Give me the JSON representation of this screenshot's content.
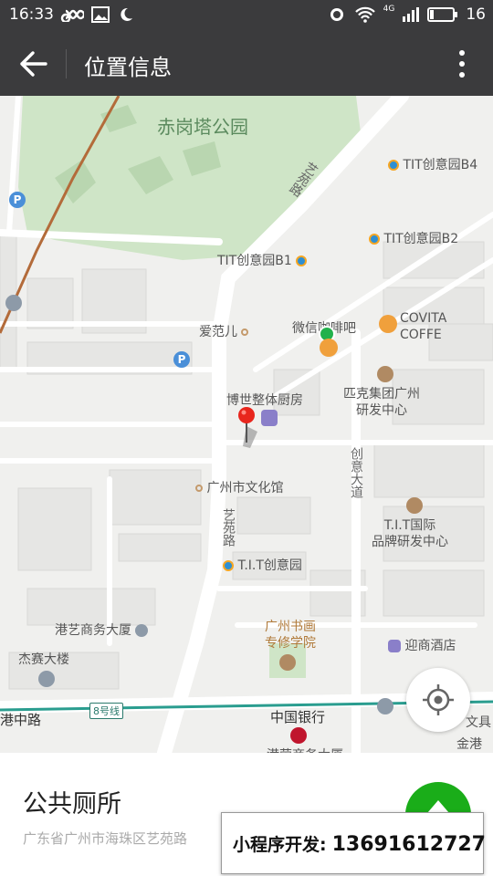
{
  "status_bar": {
    "time": "16:33",
    "network_label": "4G",
    "battery": "16"
  },
  "navbar": {
    "title": "位置信息"
  },
  "map": {
    "park_label": "赤岗塔公园",
    "roads": {
      "yiyuan_top": "艺苑路",
      "yiyuan_bottom": "艺苑路",
      "chuangyi": "创意大道",
      "ganggang": "港中路",
      "metro_line": "8号线"
    },
    "pois": {
      "tit_b4": "TIT创意园B4",
      "tit_b2": "TIT创意园B2",
      "tit_b1": "TIT创意园B1",
      "aifaner": "爱范儿",
      "weixin_cafe": "微信咖啡吧",
      "covita_1": "COVITA",
      "covita_2": "COFFE",
      "pike_1": "匹克集团广州",
      "pike_2": "研发中心",
      "boshi": "博世整体厨房",
      "culture_hall": "广州市文化馆",
      "tit_intl_1": "T.I.T国际",
      "tit_intl_2": "品牌研发中心",
      "tit_park": "T.I.T创意园",
      "gangyi": "港艺商务大厦",
      "jiesai": "杰赛大楼",
      "shuhua_1": "广州书画",
      "shuhua_2": "专修学院",
      "yingshang": "迎商酒店",
      "bank": "中国银行",
      "jingang": "金港",
      "wenyu": "文具",
      "bottom_cut": "港荣商务大厦"
    }
  },
  "place": {
    "name": "公共厕所",
    "address": "广东省广州市海珠区艺苑路"
  },
  "overlay": {
    "label": "小程序开发:",
    "phone": "13691612727"
  },
  "colors": {
    "bar": "#3b3b3d",
    "park_green": "#cfe5c7",
    "map_bg": "#f0f0ee",
    "pin_red": "#e8261d",
    "fab_green": "#1aad19",
    "metro_line": "#2a9d8f"
  },
  "icons": {
    "back": "back-arrow-icon",
    "more": "more-vertical-icon",
    "locate": "locate-crosshair-icon",
    "navigate": "navigate-icon"
  }
}
